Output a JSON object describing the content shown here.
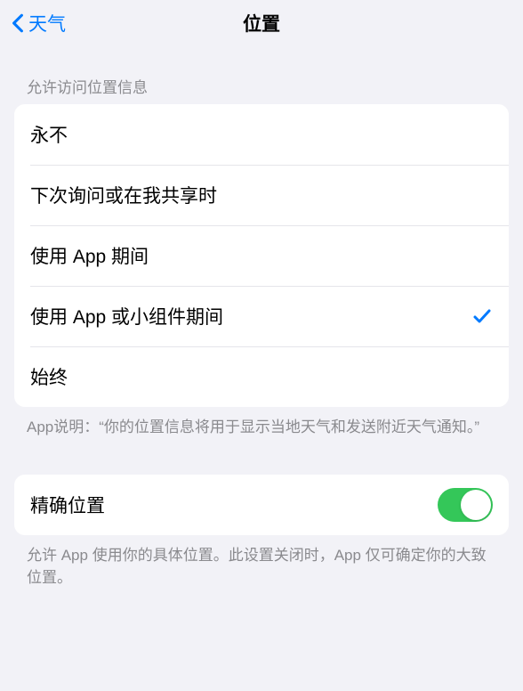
{
  "navbar": {
    "back_label": "天气",
    "title": "位置"
  },
  "location_access": {
    "header": "允许访问位置信息",
    "options": [
      {
        "label": "永不",
        "selected": false
      },
      {
        "label": "下次询问或在我共享时",
        "selected": false
      },
      {
        "label": "使用 App 期间",
        "selected": false
      },
      {
        "label": "使用 App 或小组件期间",
        "selected": true
      },
      {
        "label": "始终",
        "selected": false
      }
    ],
    "footer": "App说明：“你的位置信息将用于显示当地天气和发送附近天气通知。”"
  },
  "precise_location": {
    "label": "精确位置",
    "enabled": true,
    "footer": "允许 App 使用你的具体位置。此设置关闭时，App 仅可确定你的大致位置。"
  }
}
